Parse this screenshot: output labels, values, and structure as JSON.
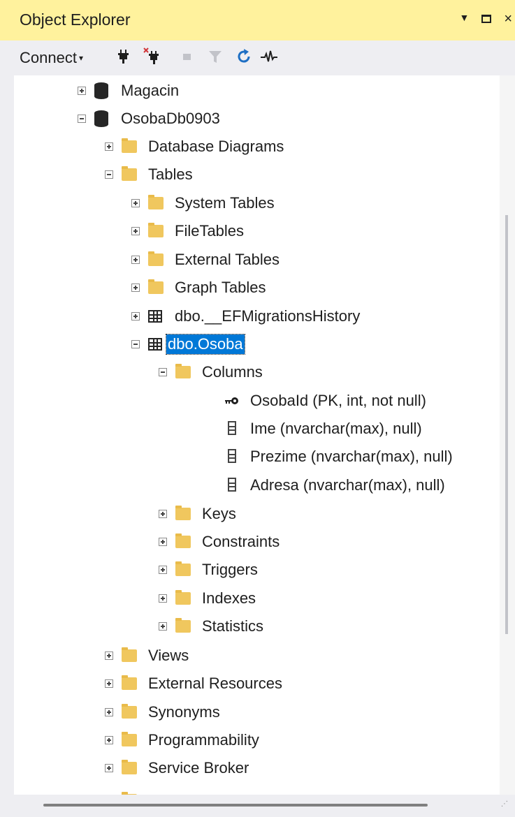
{
  "panel": {
    "title": "Object Explorer",
    "pin_icon": "pin-dropdown-icon",
    "maximize_icon": "maximize-icon",
    "close_icon": "close-icon",
    "close_glyph": "×"
  },
  "toolbar": {
    "connect_label": "Connect",
    "connect_arrow": "▾",
    "tools": [
      "connect-plug-icon",
      "disconnect-plug-icon",
      "stop-icon",
      "filter-icon",
      "refresh-icon",
      "activity-monitor-icon"
    ]
  },
  "tree": {
    "magacin": "Magacin",
    "osobadb": "OsobaDb0903",
    "database_diagrams": "Database Diagrams",
    "tables": "Tables",
    "system_tables": "System Tables",
    "file_tables": "FileTables",
    "external_tables": "External Tables",
    "graph_tables": "Graph Tables",
    "ef_migrations": "dbo.__EFMigrationsHistory",
    "dbo_osoba": "dbo.Osoba",
    "columns": "Columns",
    "col_osobaid": "OsobaId (PK, int, not null)",
    "col_ime": "Ime (nvarchar(max), null)",
    "col_prezime": "Prezime (nvarchar(max), null)",
    "col_adresa": "Adresa (nvarchar(max), null)",
    "keys": "Keys",
    "constraints": "Constraints",
    "triggers": "Triggers",
    "indexes": "Indexes",
    "statistics": "Statistics",
    "views": "Views",
    "external_resources": "External Resources",
    "synonyms": "Synonyms",
    "programmability": "Programmability",
    "service_broker": "Service Broker"
  },
  "colors": {
    "title_bar": "#fff29d",
    "selection": "#0078d7",
    "folder": "#f0c75e",
    "refresh": "#1e6fc4"
  }
}
